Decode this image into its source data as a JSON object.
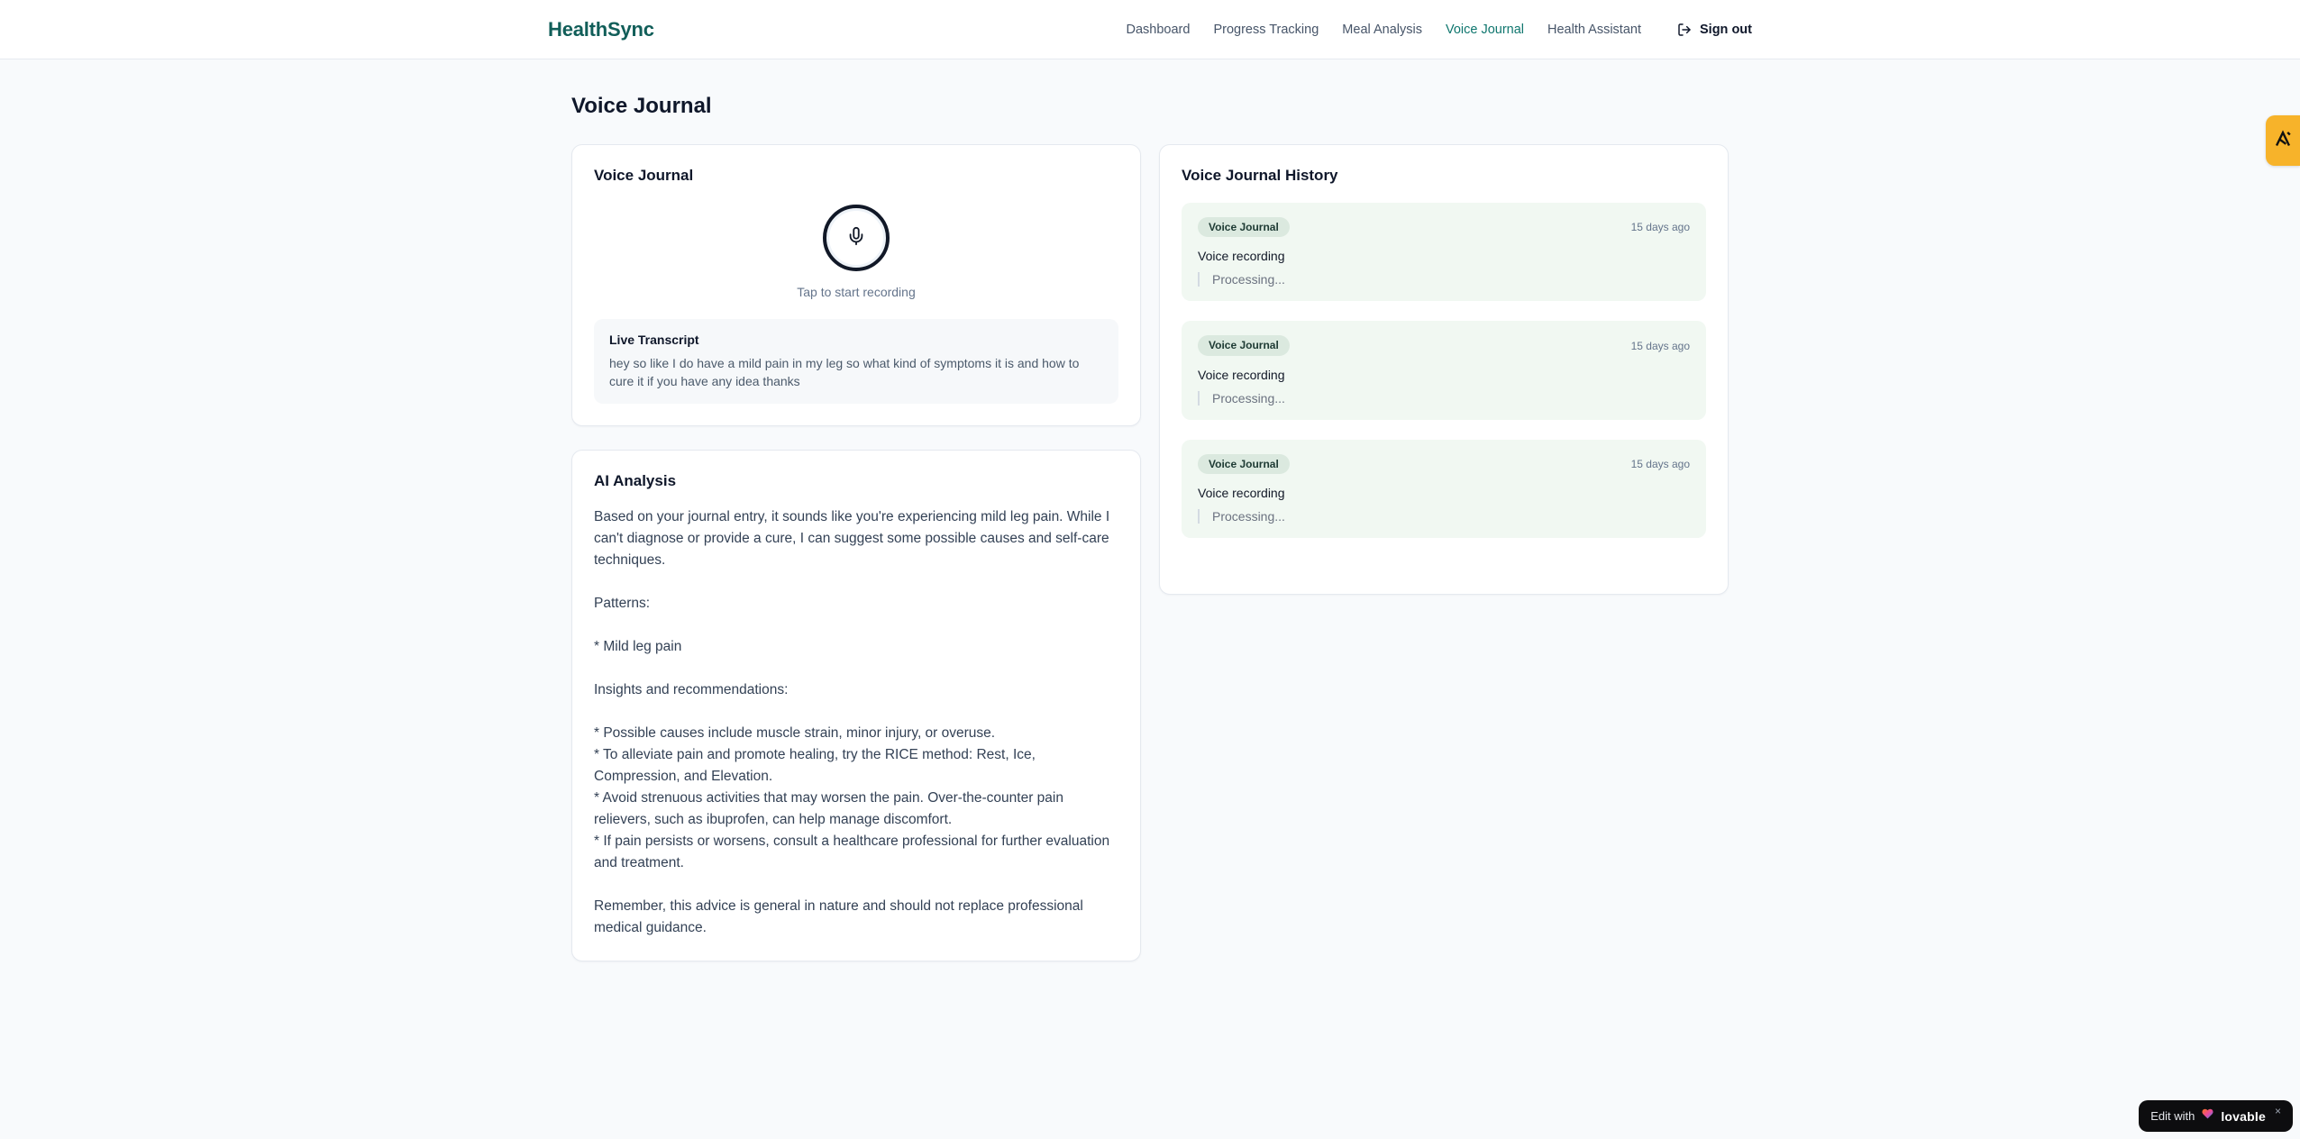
{
  "brand": {
    "name": "HealthSync",
    "color": "#115e59"
  },
  "nav": {
    "items": [
      {
        "label": "Dashboard",
        "active": false
      },
      {
        "label": "Progress Tracking",
        "active": false
      },
      {
        "label": "Meal Analysis",
        "active": false
      },
      {
        "label": "Voice Journal",
        "active": true
      },
      {
        "label": "Health Assistant",
        "active": false
      }
    ],
    "active_color": "#0f766e",
    "sign_out_label": "Sign out"
  },
  "page": {
    "title": "Voice Journal"
  },
  "recorder": {
    "card_title": "Voice Journal",
    "mic_icon": "microphone-icon",
    "tap_hint": "Tap to start recording",
    "transcript_title": "Live Transcript",
    "transcript_text": "hey so like I do have a mild pain in my leg so what kind of symptoms it is and how to cure it if you have any idea thanks"
  },
  "ai_analysis": {
    "card_title": "AI Analysis",
    "body": "Based on your journal entry, it sounds like you're experiencing mild leg pain. While I can't diagnose or provide a cure, I can suggest some possible causes and self-care techniques.\n\nPatterns:\n\n* Mild leg pain\n\nInsights and recommendations:\n\n* Possible causes include muscle strain, minor injury, or overuse.\n* To alleviate pain and promote healing, try the RICE method: Rest, Ice, Compression, and Elevation.\n* Avoid strenuous activities that may worsen the pain. Over-the-counter pain relievers, such as ibuprofen, can help manage discomfort.\n* If pain persists or worsens, consult a healthcare professional for further evaluation and treatment.\n\nRemember, this advice is general in nature and should not replace professional medical guidance."
  },
  "history": {
    "card_title": "Voice Journal History",
    "entry_bg": "#f1f8f2",
    "badge_bg": "#dbe9df",
    "entries": [
      {
        "badge": "Voice Journal",
        "timestamp": "15 days ago",
        "title": "Voice recording",
        "status": "Processing..."
      },
      {
        "badge": "Voice Journal",
        "timestamp": "15 days ago",
        "title": "Voice recording",
        "status": "Processing..."
      },
      {
        "badge": "Voice Journal",
        "timestamp": "15 days ago",
        "title": "Voice recording",
        "status": "Processing..."
      }
    ]
  },
  "overlay": {
    "tab_icon": "lovable-tab-icon",
    "tab_color": "#f7b32a",
    "edit_prefix": "Edit with",
    "edit_brand": "lovable",
    "close_label": "×",
    "pill_bg": "#0d0d0f"
  }
}
